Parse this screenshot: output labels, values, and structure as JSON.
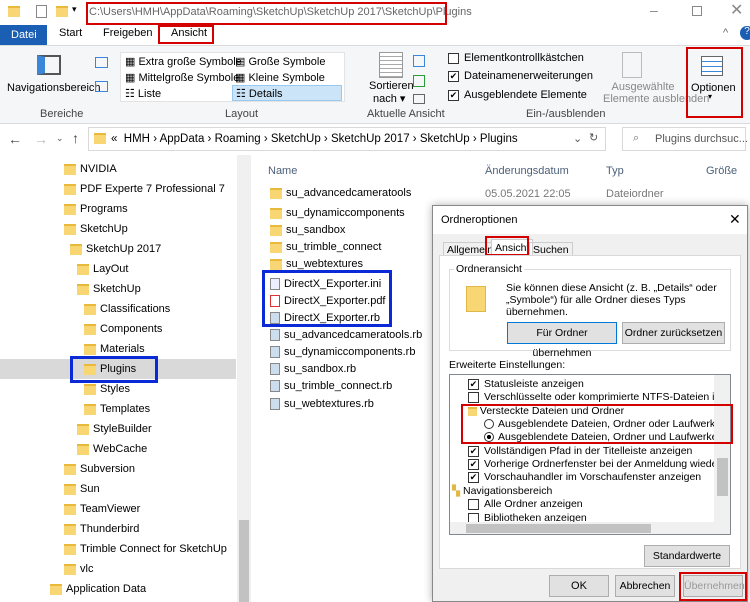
{
  "title_path": "C:\\Users\\HMH\\AppData\\Roaming\\SketchUp\\SketchUp 2017\\SketchUp\\Plugins",
  "tabs": [
    "Datei",
    "Start",
    "Freigeben",
    "Ansicht"
  ],
  "ribbon": {
    "nav_pane": "Navigationsbereich",
    "group_bereiche": "Bereiche",
    "layout": [
      "Extra große Symbole",
      "Große Symbole",
      "Mittelgroße Symbole",
      "Kleine Symbole",
      "Liste",
      "Details"
    ],
    "group_layout": "Layout",
    "sort": "Sortieren",
    "sort2": "nach",
    "group_view": "Aktuelle Ansicht",
    "checks": [
      {
        "label": "Elementkontrollkästchen",
        "checked": false
      },
      {
        "label": "Dateinamenerweiterungen",
        "checked": true
      },
      {
        "label": "Ausgeblendete Elemente",
        "checked": true
      }
    ],
    "hide_sel1": "Ausgewählte",
    "hide_sel2": "Elemente ausblenden",
    "group_show": "Ein-/ausblenden",
    "options": "Optionen"
  },
  "breadcrumb": [
    "«",
    "HMH",
    "AppData",
    "Roaming",
    "SketchUp",
    "SketchUp 2017",
    "SketchUp",
    "Plugins"
  ],
  "search_placeholder": "Plugins durchsuc...",
  "tree": [
    "NVIDIA",
    "PDF Experte 7 Professional 7",
    "Programs",
    "SketchUp",
    "SketchUp 2017",
    "LayOut",
    "SketchUp",
    "Classifications",
    "Components",
    "Materials",
    "Plugins",
    "Styles",
    "Templates",
    "StyleBuilder",
    "WebCache",
    "Subversion",
    "Sun",
    "TeamViewer",
    "Thunderbird",
    "Trimble Connect for SketchUp",
    "vlc",
    "Application Data"
  ],
  "columns": [
    "Name",
    "Änderungsdatum",
    "Typ",
    "Größe"
  ],
  "files": [
    {
      "name": "su_advancedcameratools",
      "date": "05.05.2021 22:05",
      "type": "Dateiordner"
    },
    {
      "name": "su_dynamiccomponents"
    },
    {
      "name": "su_sandbox"
    },
    {
      "name": "su_trimble_connect"
    },
    {
      "name": "su_webtextures"
    },
    {
      "name": "DirectX_Exporter.ini"
    },
    {
      "name": "DirectX_Exporter.pdf"
    },
    {
      "name": "DirectX_Exporter.rb"
    },
    {
      "name": "su_advancedcameratools.rb"
    },
    {
      "name": "su_dynamiccomponents.rb"
    },
    {
      "name": "su_sandbox.rb"
    },
    {
      "name": "su_trimble_connect.rb"
    },
    {
      "name": "su_webtextures.rb"
    }
  ],
  "dialog": {
    "title": "Ordneroptionen",
    "tabs": [
      "Allgemein",
      "Ansicht",
      "Suchen"
    ],
    "group": "Ordneransicht",
    "desc": "Sie können diese Ansicht (z. B. „Details“ oder „Symbole“) für alle Ordner dieses Typs übernehmen.",
    "apply_folders": "Für Ordner übernehmen",
    "reset_folders": "Ordner zurücksetzen",
    "advanced": "Erweiterte Einstellungen:",
    "options": [
      "Statusleiste anzeigen",
      "Verschlüsselte oder komprimierte NTFS-Dateien in anderer",
      "Versteckte Dateien und Ordner",
      "Ausgeblendete Dateien, Ordner oder Laufwerke nicht a",
      "Ausgeblendete Dateien, Ordner und Laufwerke anzeige",
      "Vollständigen Pfad in der Titelleiste anzeigen",
      "Vorherige Ordnerfenster bei der Anmeldung wiederherstellen",
      "Vorschauhandler im Vorschaufenster anzeigen",
      "Navigationsbereich",
      "Alle Ordner anzeigen",
      "Bibliotheken anzeigen"
    ],
    "defaults": "Standardwerte",
    "ok": "OK",
    "cancel": "Abbrechen",
    "apply": "Übernehmen"
  }
}
